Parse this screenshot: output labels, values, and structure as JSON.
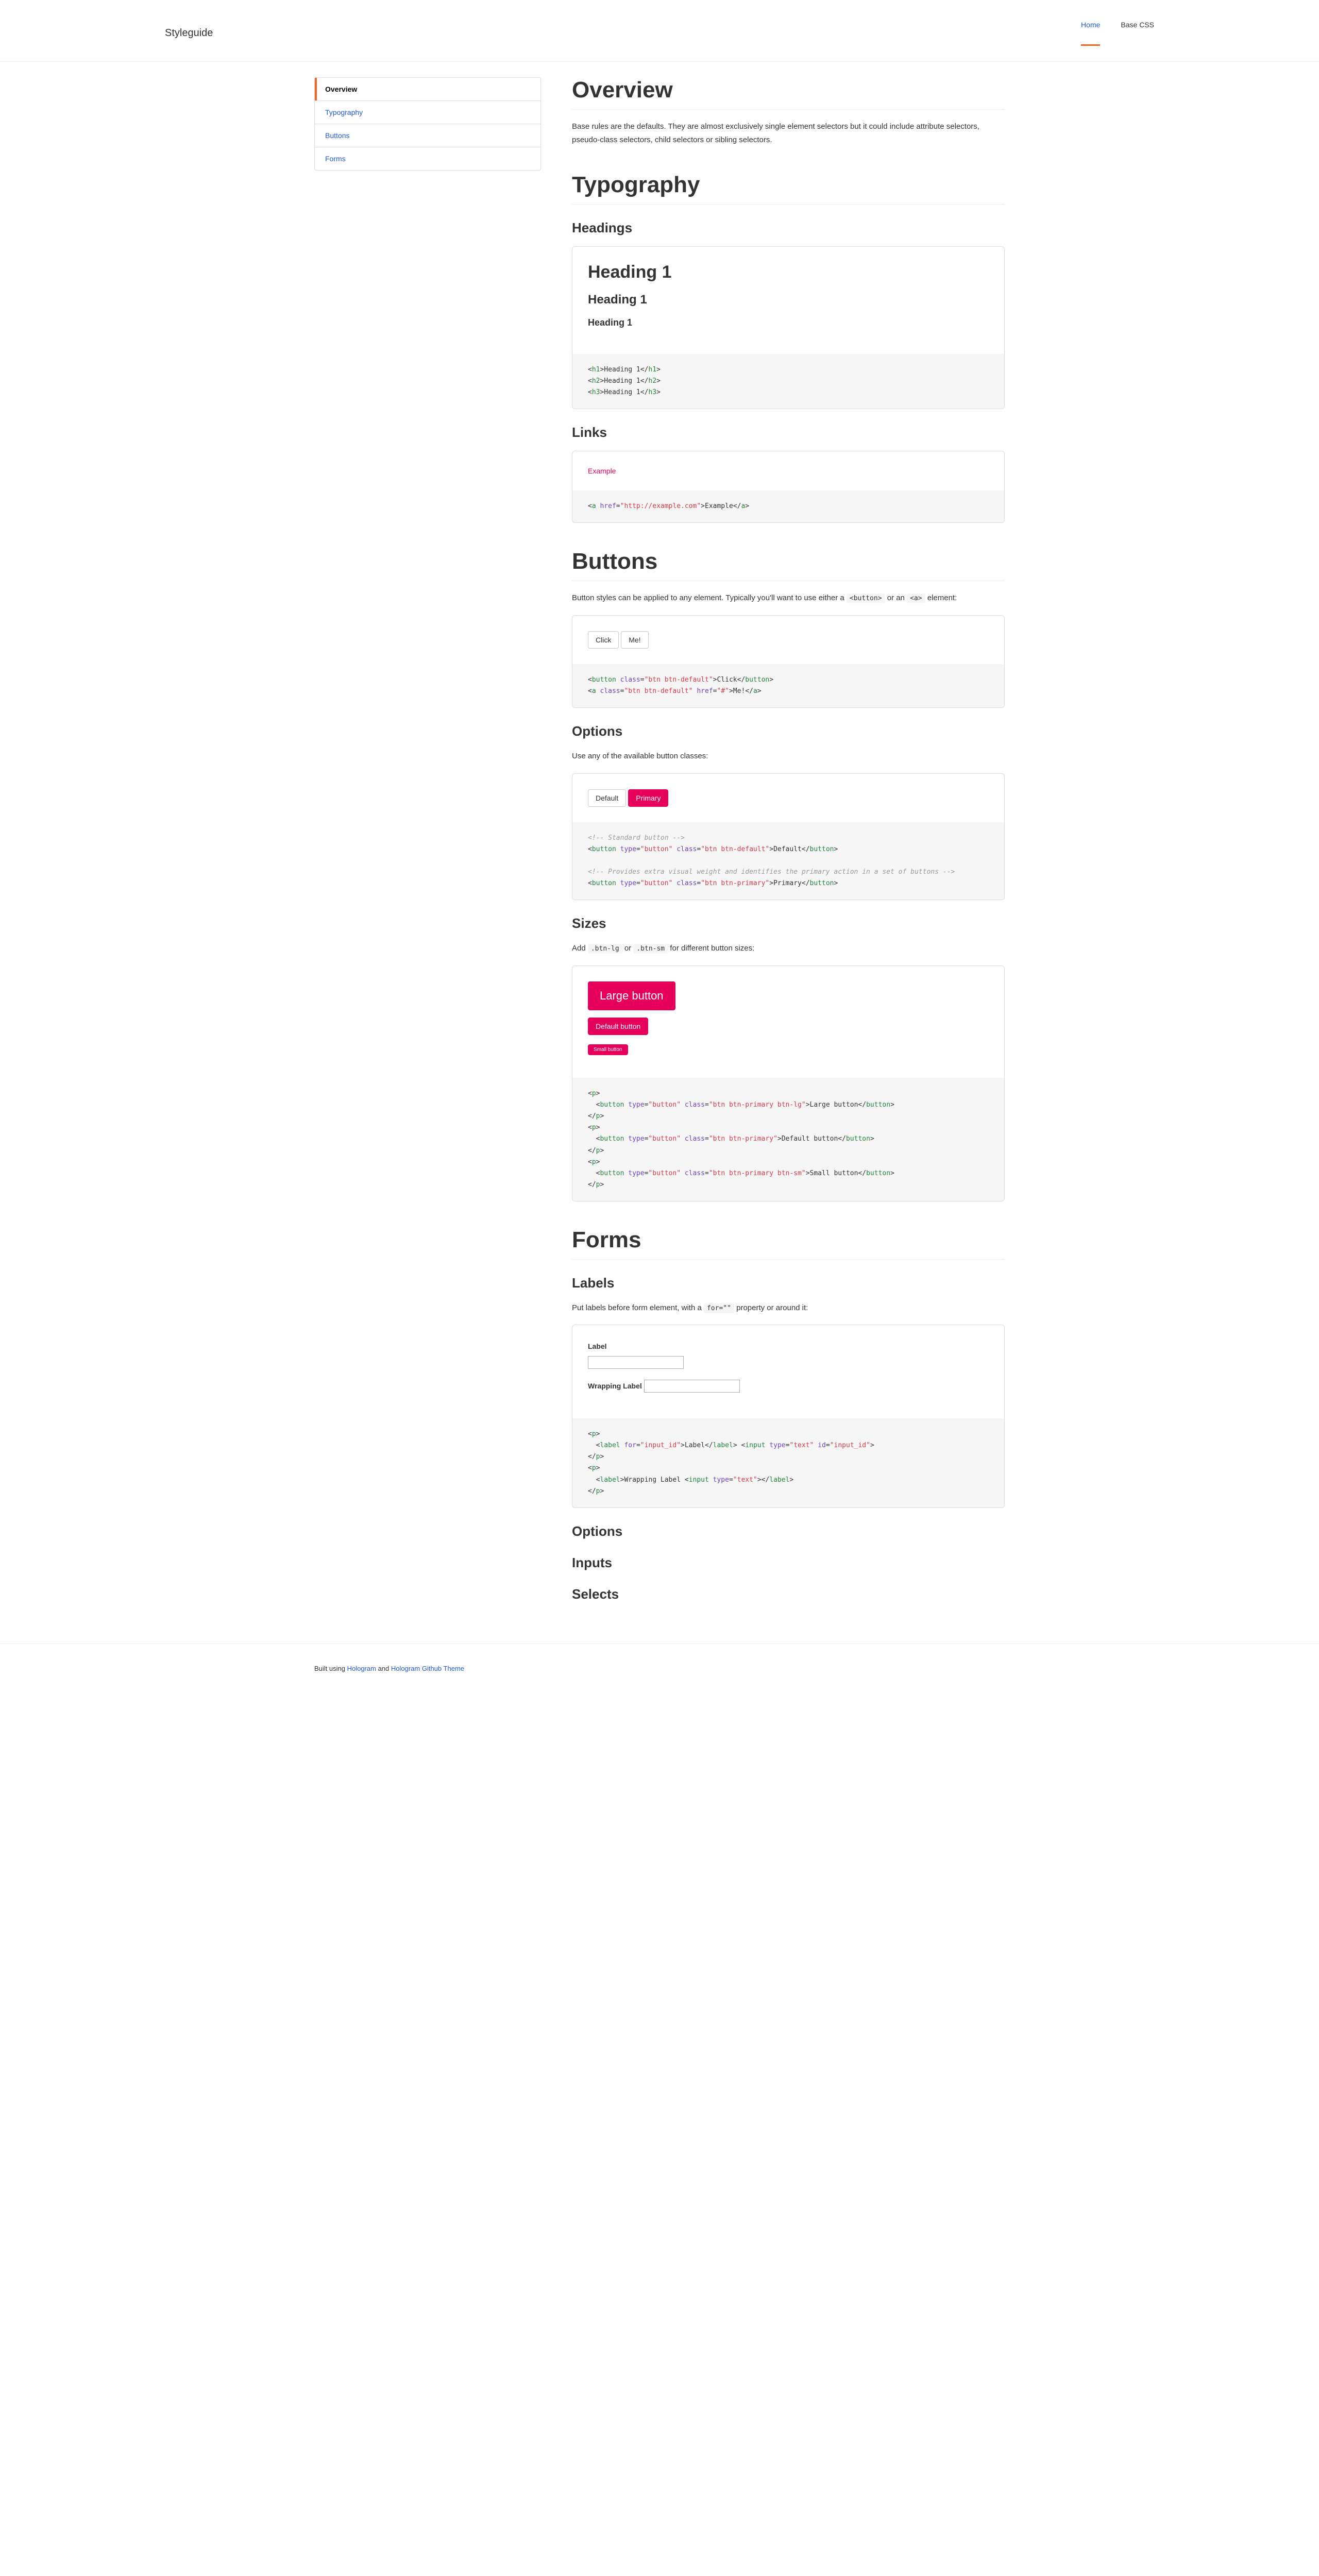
{
  "header": {
    "logo": "Styleguide",
    "nav": {
      "home": "Home",
      "base": "Base CSS"
    }
  },
  "sidebar": {
    "items": [
      "Overview",
      "Typography",
      "Buttons",
      "Forms"
    ]
  },
  "overview": {
    "title": "Overview",
    "text": "Base rules are the defaults. They are almost exclusively single element selectors but it could include attribute selectors, pseudo-class selectors, child selectors or sibling selectors."
  },
  "typography": {
    "title": "Typography",
    "headings": {
      "title": "Headings",
      "h1": "Heading 1",
      "h2": "Heading 1",
      "h3": "Heading 1"
    },
    "links": {
      "title": "Links",
      "example": "Example"
    }
  },
  "buttons": {
    "title": "Buttons",
    "intro1": "Button styles can be applied to any element. Typically you'll want to use either a ",
    "intro2": " or an ",
    "intro3": " element:",
    "code1": "<button>",
    "code2": "<a>",
    "click": "Click",
    "me": "Me!",
    "options": {
      "title": "Options",
      "text": "Use any of the available button classes:",
      "default": "Default",
      "primary": "Primary"
    },
    "sizes": {
      "title": "Sizes",
      "text1": "Add ",
      "lg": ".btn-lg",
      "text2": " or ",
      "sm": ".btn-sm",
      "text3": " for different button sizes:",
      "large": "Large button",
      "default": "Default button",
      "small": "Small button"
    }
  },
  "forms": {
    "title": "Forms",
    "labels": {
      "title": "Labels",
      "text1": "Put labels before form element, with a ",
      "for": "for=\"\"",
      "text2": " property or around it:",
      "label": "Label",
      "wrapping": "Wrapping Label"
    },
    "options": "Options",
    "inputs": "Inputs",
    "selects": "Selects"
  },
  "footer": {
    "text1": "Built using ",
    "link1": "Hologram",
    "text2": " and ",
    "link2": "Hologram Github Theme"
  }
}
